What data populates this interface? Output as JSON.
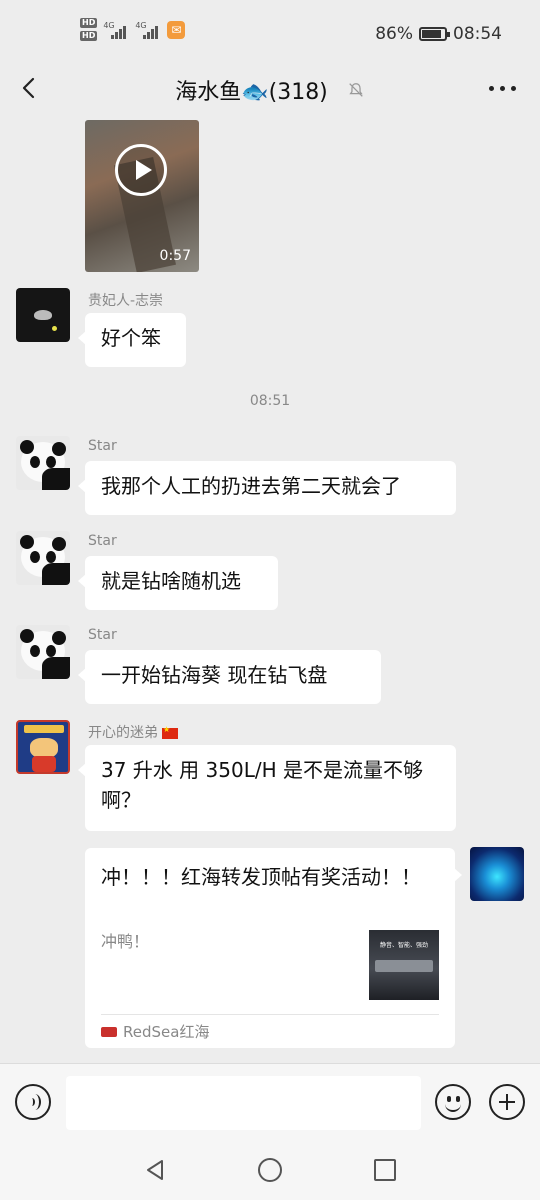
{
  "status_bar": {
    "hd1": "HD",
    "hd2": "HD",
    "net1": "4G",
    "net2": "4G",
    "battery_percent": "86%",
    "battery_level": 0.86,
    "time": "08:54"
  },
  "header": {
    "title": "海水鱼🐟(318)",
    "back_icon": "chevron-left-icon",
    "mute_icon": "bell-off-icon",
    "more_icon": "more-dots-icon"
  },
  "video": {
    "duration": "0:57",
    "play_icon": "play-icon"
  },
  "messages": [
    {
      "sender": "贵妃人-志崇",
      "text": "好个笨"
    },
    {
      "timestamp": "08:51"
    },
    {
      "sender": "Star",
      "text": "我那个人工的扔进去第二天就会了"
    },
    {
      "sender": "Star",
      "text": "就是钻啥随机选"
    },
    {
      "sender": "Star",
      "text": "一开始钻海葵  现在钻飞盘"
    },
    {
      "sender": "开心的迷弟",
      "text": "37 升水  用 350L/H  是不是流量不够啊？"
    }
  ],
  "link_card": {
    "title": "冲！！！红海转发顶帖有奖活动！！",
    "description": "冲鸭！",
    "thumb_text": "静音、智能、强劲",
    "source": "RedSea红海"
  },
  "input_bar": {
    "placeholder": "",
    "voice_icon": "voice-icon",
    "emoji_icon": "emoji-icon",
    "plus_icon": "plus-icon"
  },
  "system_nav": {
    "back_icon": "triangle-back-icon",
    "home_icon": "circle-home-icon",
    "recent_icon": "square-recent-icon"
  },
  "colors": {
    "background": "#ededed",
    "bubble": "#ffffff",
    "meta_text": "#888888"
  }
}
